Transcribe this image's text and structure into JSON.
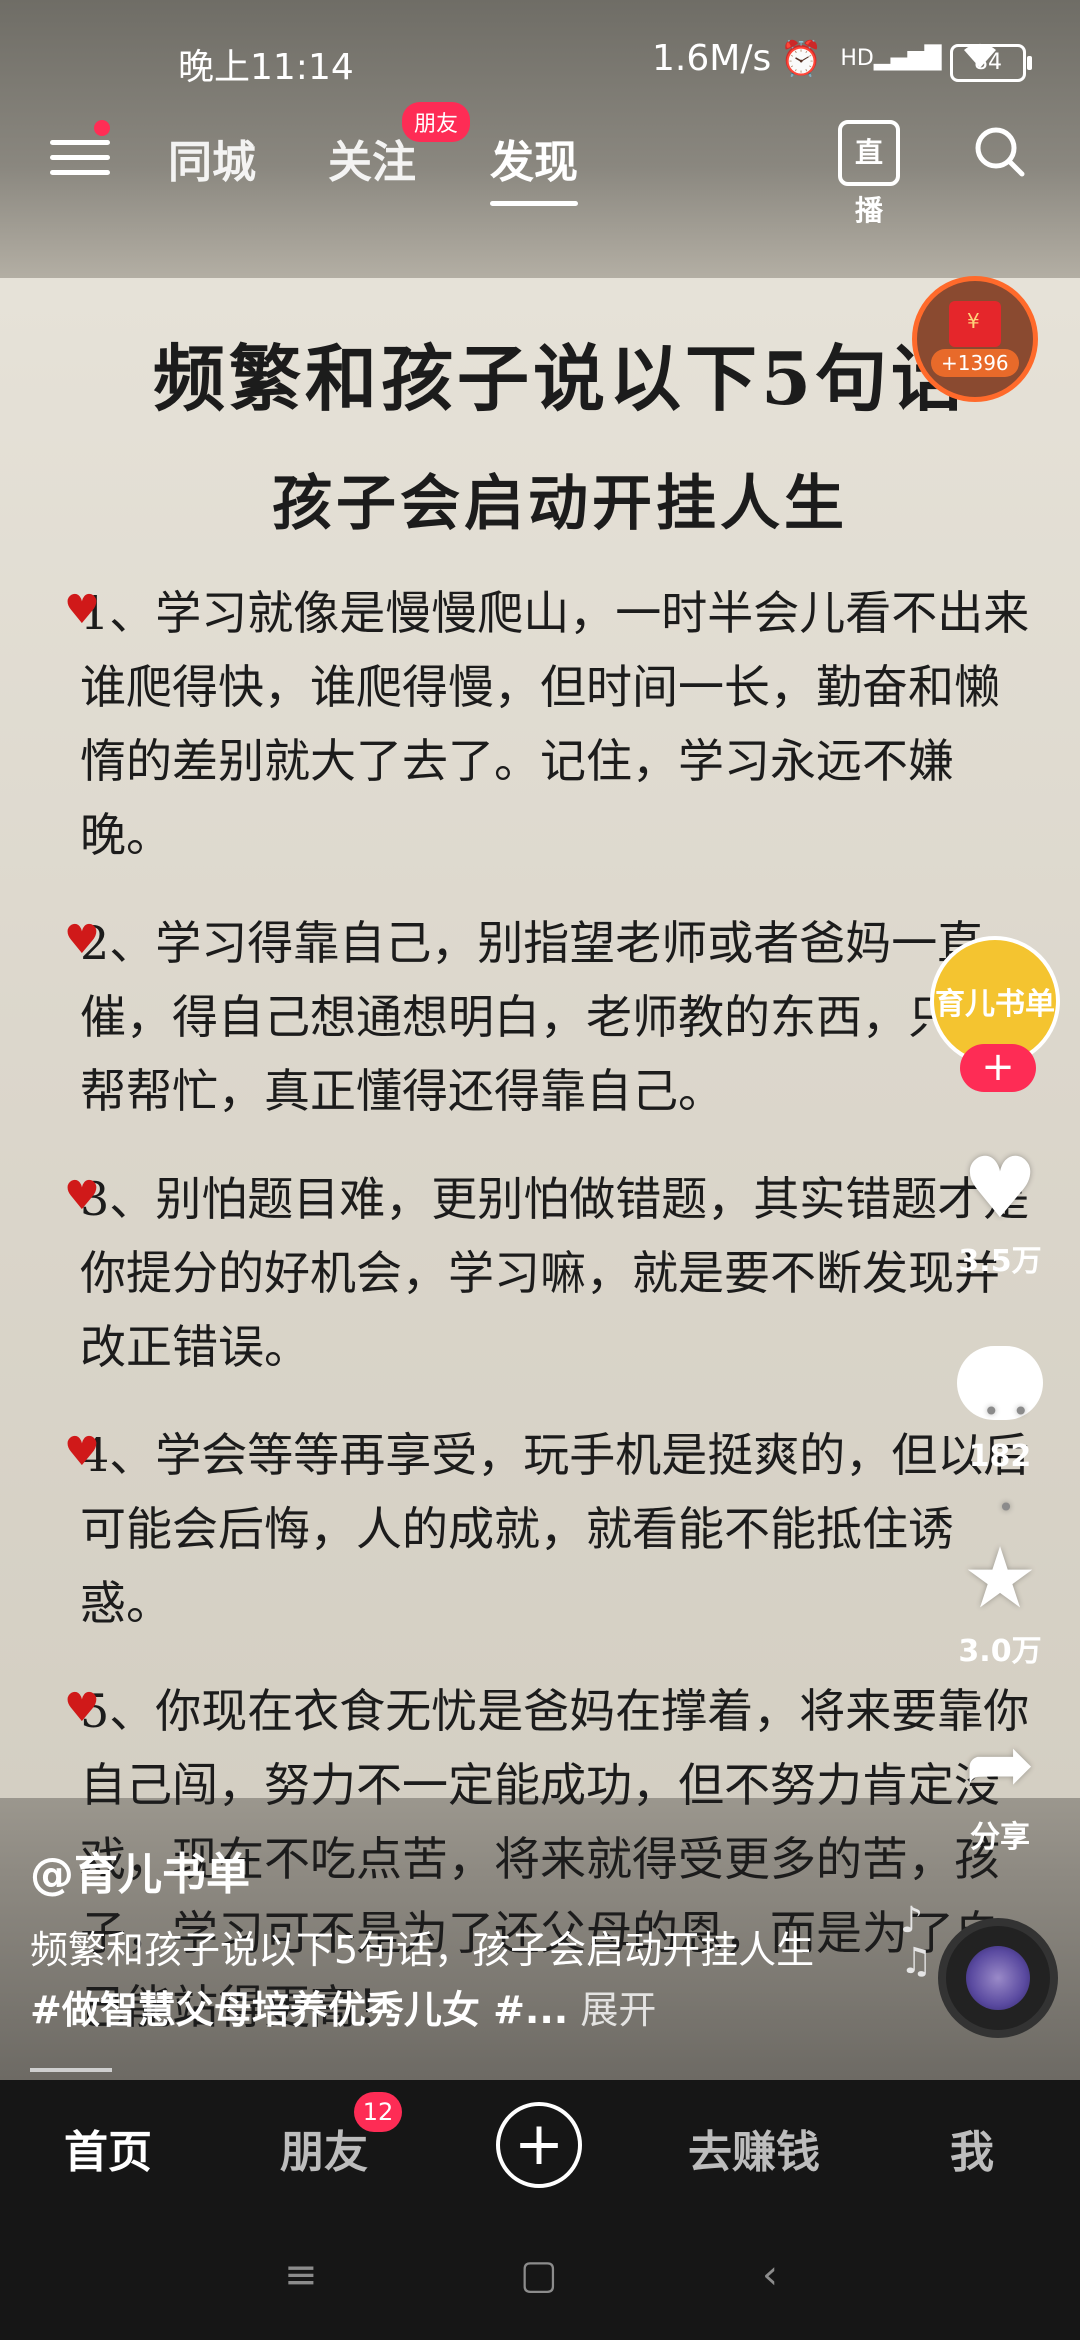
{
  "status_bar": {
    "time": "晚上11:14",
    "speed": "1.6M/s",
    "alarm_icon": "alarm-icon",
    "signal_label": "HD",
    "battery": "84"
  },
  "top_nav": {
    "tabs": [
      {
        "label": "同城"
      },
      {
        "label": "关注",
        "badge": "朋友"
      },
      {
        "label": "发现",
        "active": true
      }
    ],
    "live_label": "直播"
  },
  "video": {
    "title_line1": "频繁和孩子说以下5句话",
    "title_line2": "孩子会启动开挂人生",
    "items": [
      "1、学习就像是慢慢爬山，一时半会儿看不出来谁爬得快，谁爬得慢，但时间一长，勤奋和懒惰的差别就大了去了。记住，学习永远不嫌晚。",
      "2、学习得靠自己，别指望老师或者爸妈一直催，得自己想通想明白，老师教的东西，只是帮帮忙，真正懂得还得靠自己。",
      "3、别怕题目难，更别怕做错题，其实错题才是你提分的好机会，学习嘛，就是要不断发现并改正错误。",
      "4、学会等等再享受，玩手机是挺爽的，但以后可能会后悔，人的成就，就看能不能抵住诱惑。",
      "5、你现在衣食无忧是爸妈在撑着，将来要靠你自己闯，努力不一定能成功，但不努力肯定没戏，现在不吃点苦，将来就得受更多的苦，孩子，学习可不是为了还父母的恩，而是为了自己能站得更高！"
    ]
  },
  "side_actions": {
    "red_packet": "+1396",
    "avatar_name": "育儿书单",
    "likes": "3.5万",
    "comments": "182",
    "favorites": "3.0万",
    "share": "分享"
  },
  "info": {
    "author": "@育儿书单",
    "description": "频繁和孩子说以下5句话，孩子会启动开挂人生 ",
    "hashtag": "#做智慧父母培养优秀儿女 #...",
    "expand": "展开"
  },
  "bottom_tabs": {
    "home": "首页",
    "friends": "朋友",
    "friends_badge": "12",
    "earn": "去赚钱",
    "me": "我"
  },
  "colors": {
    "accent": "#fe2c55",
    "tabbar_bg": "#161616"
  }
}
